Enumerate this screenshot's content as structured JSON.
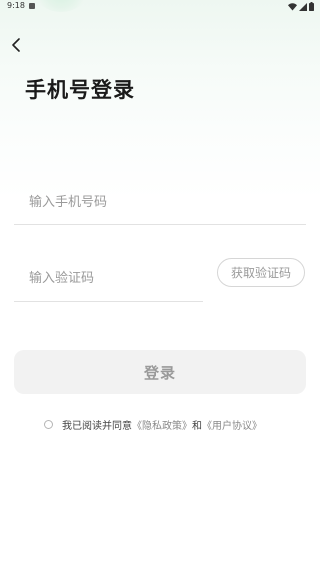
{
  "status_bar": {
    "time": "9:18",
    "icons": [
      "app-notification-icon",
      "wifi-icon",
      "signal-icon",
      "battery-icon"
    ]
  },
  "nav": {
    "back_icon": "chevron-left-icon"
  },
  "title": "手机号登录",
  "phone": {
    "placeholder": "输入手机号码",
    "value": ""
  },
  "code": {
    "placeholder": "输入验证码",
    "value": "",
    "get_code_label": "获取验证码"
  },
  "login_label": "登录",
  "agreement": {
    "checked": false,
    "prefix": "我已阅读并同意",
    "privacy_link": "《隐私政策》",
    "conjunction": "和",
    "terms_link": "《用户协议》"
  },
  "colors": {
    "title": "#1a1a1a",
    "placeholder": "#9a9a9a",
    "button_bg": "#f2f2f2",
    "button_text": "#9a9a9a",
    "link": "#8a8a8a",
    "gradient_top": "#eef7f1"
  }
}
